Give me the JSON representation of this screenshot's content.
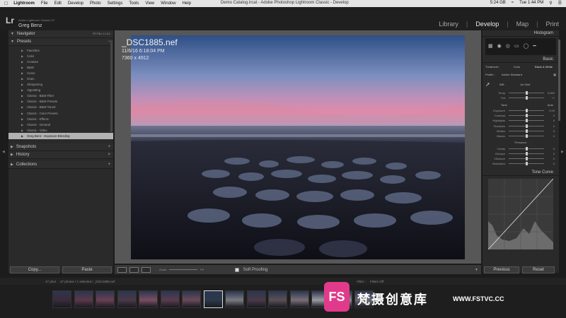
{
  "menubar": {
    "app": "Lightroom",
    "items": [
      "File",
      "Edit",
      "Develop",
      "Photo",
      "Settings",
      "Tools",
      "View",
      "Window",
      "Help"
    ],
    "window_title": "Demo Catalog.lrcat - Adobe Photoshop Lightroom Classic - Develop",
    "battery": "5:24 GB",
    "time": "Tue 1:44 PM"
  },
  "identity": {
    "logo": "Lr",
    "sub": "Adobe Lightroom Classic CC",
    "name": "Greg Benz"
  },
  "modules": [
    "Library",
    "Develop",
    "Map",
    "Print"
  ],
  "left": {
    "navigator": "Navigator",
    "navigator_right": "FIT FILL 1:1 3:1",
    "presets": "Presets",
    "preset_items": [
      "Favorites",
      "Color",
      "Creative",
      "B&W",
      "Curve",
      "Grain",
      "Sharpening",
      "Vignetting",
      "Classic - B&W Filter",
      "Classic - B&W Presets",
      "Classic - B&W Toned",
      "Classic - Color Presets",
      "Classic - Effects",
      "Classic - General",
      "Classic - Video",
      "Greg Benz - Exposure Blending"
    ],
    "snapshots": "Snapshots",
    "history": "History",
    "collections": "Collections",
    "copy": "Copy...",
    "paste": "Paste"
  },
  "photo": {
    "filename": "_DSC1885.nef",
    "date": "11/6/16 6:18:04 PM",
    "dims": "7360 x 4912"
  },
  "toolbar": {
    "zoom": "Zoom",
    "fit": "Fit",
    "soft": "Soft Proofing"
  },
  "right": {
    "histogram": "Histogram",
    "basic": "Basic",
    "treatment": [
      "Treatment :",
      "Color",
      "Black & White"
    ],
    "profile": [
      "Profile :",
      "Adobe Standard"
    ],
    "wb": [
      "WB :",
      "As Shot"
    ],
    "wb_rows": [
      {
        "l": "Temp",
        "v": "5,850"
      },
      {
        "l": "Tint",
        "v": "+7"
      }
    ],
    "tone": "Tone",
    "auto": "Auto",
    "tone_rows": [
      {
        "l": "Exposure",
        "v": "0.00"
      },
      {
        "l": "Contrast",
        "v": "0"
      },
      {
        "l": "Highlights",
        "v": "0"
      },
      {
        "l": "Shadows",
        "v": "0"
      },
      {
        "l": "Whites",
        "v": "0"
      },
      {
        "l": "Blacks",
        "v": "0"
      }
    ],
    "presence": "Presence",
    "presence_rows": [
      {
        "l": "Clarity",
        "v": "0"
      },
      {
        "l": "Dehaze",
        "v": "0"
      },
      {
        "l": "Vibrance",
        "v": "0"
      },
      {
        "l": "Saturation",
        "v": "0"
      }
    ],
    "tone_curve": "Tone Curve",
    "previous": "Previous",
    "reset": "Reset"
  },
  "filmbar": {
    "source": "Folder",
    "count": "47 phot",
    "selection": "47 photos / 1 selected / _DSC1885.nef",
    "filter": "Filter :",
    "filter_value": "Filters Off"
  },
  "watermark": {
    "logo": "FS",
    "cn": "梵摄创意库",
    "url": "WWW.FSTVC.CC"
  },
  "colors": {
    "accent": "#e8e8e8",
    "panel": "#2a2a2a",
    "selected": "#b2b2b2",
    "watermark": "#e23a8a"
  }
}
